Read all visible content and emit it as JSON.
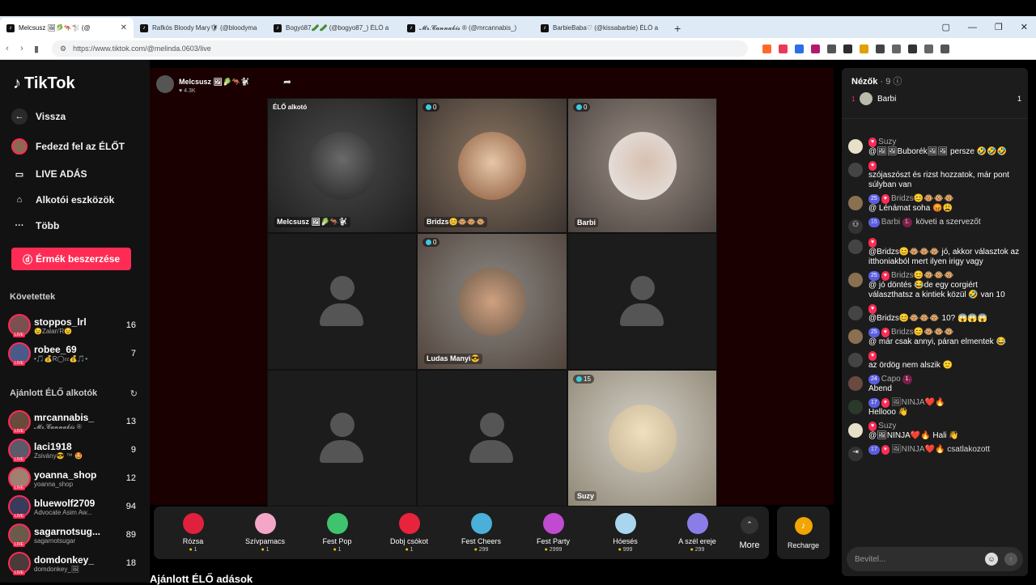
{
  "browser": {
    "tabs": [
      {
        "title": "Melcsusz 🖼🥬🦘🐩 (@"
      },
      {
        "title": "Rafkós Bloody Mary🛡 (@bloodyma"
      },
      {
        "title": "Bogyó87🥒🥒 (@bogyo87_) ÉLŐ a"
      },
      {
        "title": "𝓜𝓻.𝓒𝓪𝓷𝓷𝓪𝓫𝓲𝓼 ® (@mrcannabis_)"
      },
      {
        "title": "BarbieBaba♡ (@kissabarbie) ÉLŐ a"
      }
    ],
    "new_tab": "+",
    "url": "https://www.tiktok.com/@melinda.0603/live"
  },
  "sidebar": {
    "logo": "TikTok",
    "nav": [
      {
        "label": "Vissza",
        "icon": "arrow-left-icon"
      },
      {
        "label": "Fedezd fel az ÉLŐT",
        "icon": "avatar-icon"
      },
      {
        "label": "LIVE ADÁS",
        "icon": "video-icon"
      },
      {
        "label": "Alkotói eszközök",
        "icon": "creator-tools-icon"
      },
      {
        "label": "Több",
        "icon": "more-icon"
      }
    ],
    "coin_button": "Érmék beszerzése",
    "following_title": "Követettek",
    "following": [
      {
        "name": "stoppos_lrl",
        "sub": "😉Zalan'R😉",
        "count": "16"
      },
      {
        "name": "robee_69",
        "sub": "•🎵💰R◯𝔢𝔢💰🎵•",
        "count": "7"
      }
    ],
    "recommended_title": "Ajánlott ÉLŐ alkotók",
    "recommended": [
      {
        "name": "mrcannabis_",
        "sub": "𝓜𝓻.𝓒𝓪𝓷𝓷𝓪𝓫𝓲𝓼 ®",
        "count": "13"
      },
      {
        "name": "laci1918",
        "sub": "Zsivány😎 ™ 🤩",
        "count": "9"
      },
      {
        "name": "yoanna_shop",
        "sub": "yoanna_shop",
        "count": "12"
      },
      {
        "name": "bluewolf2709",
        "sub": "Advocate Asim Aw...",
        "count": "94"
      },
      {
        "name": "sagarnotsug...",
        "sub": "sagarnotsugar",
        "count": "89"
      },
      {
        "name": "domdonkey_",
        "sub": "domdonkey_🖼",
        "count": "18"
      }
    ]
  },
  "stream": {
    "host": "Melcsusz 🖼🥬🦘🐩",
    "likes": "♥ 4.3K",
    "cells": [
      {
        "top": "ÉLŐ alkotó",
        "label": "Melcsusz 🖼🥬🦘🐩",
        "score": ""
      },
      {
        "top": "",
        "label": "Bridzs😊🐵🐵🐵",
        "score": "0"
      },
      {
        "top": "",
        "label": "Barbi",
        "score": "0"
      },
      {
        "top": "",
        "label": "",
        "score": ""
      },
      {
        "top": "",
        "label": "Ludas Manyi😎",
        "score": "0"
      },
      {
        "top": "",
        "label": "",
        "score": ""
      },
      {
        "top": "",
        "label": "",
        "score": ""
      },
      {
        "top": "",
        "label": "",
        "score": ""
      },
      {
        "top": "",
        "label": "Suzy",
        "score": "15"
      }
    ]
  },
  "gifts": [
    {
      "name": "Rózsa",
      "price": "1",
      "color": "#e0213d"
    },
    {
      "name": "Szívpamacs",
      "price": "1",
      "color": "#f3a6c8"
    },
    {
      "name": "Fest Pop",
      "price": "1",
      "color": "#3fc36f"
    },
    {
      "name": "Dobj csókot",
      "price": "1",
      "color": "#e8233c"
    },
    {
      "name": "Fest Cheers",
      "price": "299",
      "color": "#4ab0d9"
    },
    {
      "name": "Fest Party",
      "price": "2999",
      "color": "#c04ad0"
    },
    {
      "name": "Hóesés",
      "price": "999",
      "color": "#a9d6ee"
    },
    {
      "name": "A szél ereje",
      "price": "299",
      "color": "#8a7de8"
    }
  ],
  "more_label": "More",
  "recharge_label": "Recharge",
  "bottom_title": "Ajánlott ÉLŐ adások",
  "chat": {
    "viewers_title": "Nézők",
    "viewers_count": "· 9",
    "top_viewer": {
      "rank": "1",
      "name": "Barbi",
      "count": "1"
    },
    "messages": [
      {
        "user": "Suzy",
        "lvl": "",
        "text": "@🖼🖼Buborék🖼🖼 persze 🤣🤣🤣"
      },
      {
        "user": "",
        "lvl": "",
        "text": "szójaszószt és rizst hozzatok, már pont súlyban van"
      },
      {
        "user": "Bridzs😊🐵🐵🐵",
        "lvl": "25",
        "text": "@ Lénámat soha 😡😩"
      },
      {
        "user": "Barbi",
        "lvl": "15",
        "text": "követi a szervezőt",
        "system": true
      },
      {
        "user": "",
        "lvl": "",
        "text": "@Bridzs😊🐵🐵🐵 jó, akkor választok az itthoniakból mert ilyen irigy vagy"
      },
      {
        "user": "Bridzs😊🐵🐵🐵",
        "lvl": "25",
        "text": "@ jó döntés 😂de egy corgiért választhatsz a kintiek közül 🤣 van 10"
      },
      {
        "user": "",
        "lvl": "",
        "text": "@Bridzs😊🐵🐵🐵 10? 😱😱😱"
      },
      {
        "user": "Bridzs😊🐵🐵🐵",
        "lvl": "25",
        "text": "@ már csak annyi, páran elmentek 😂"
      },
      {
        "user": "",
        "lvl": "",
        "text": "az ördög nem alszik 🙂"
      },
      {
        "user": "Capo",
        "lvl": "24",
        "text": "Abend"
      },
      {
        "user": "🖼NINJA❤️🔥",
        "lvl": "17",
        "text": "Hellooo 👋"
      },
      {
        "user": "Suzy",
        "lvl": "",
        "text": "@🖼NINJA❤️🔥 Hali 👋"
      },
      {
        "user": "🖼NINJA❤️🔥",
        "lvl": "17",
        "text": "csatlakozott",
        "system": true
      }
    ],
    "input_placeholder": "Bevitel..."
  }
}
